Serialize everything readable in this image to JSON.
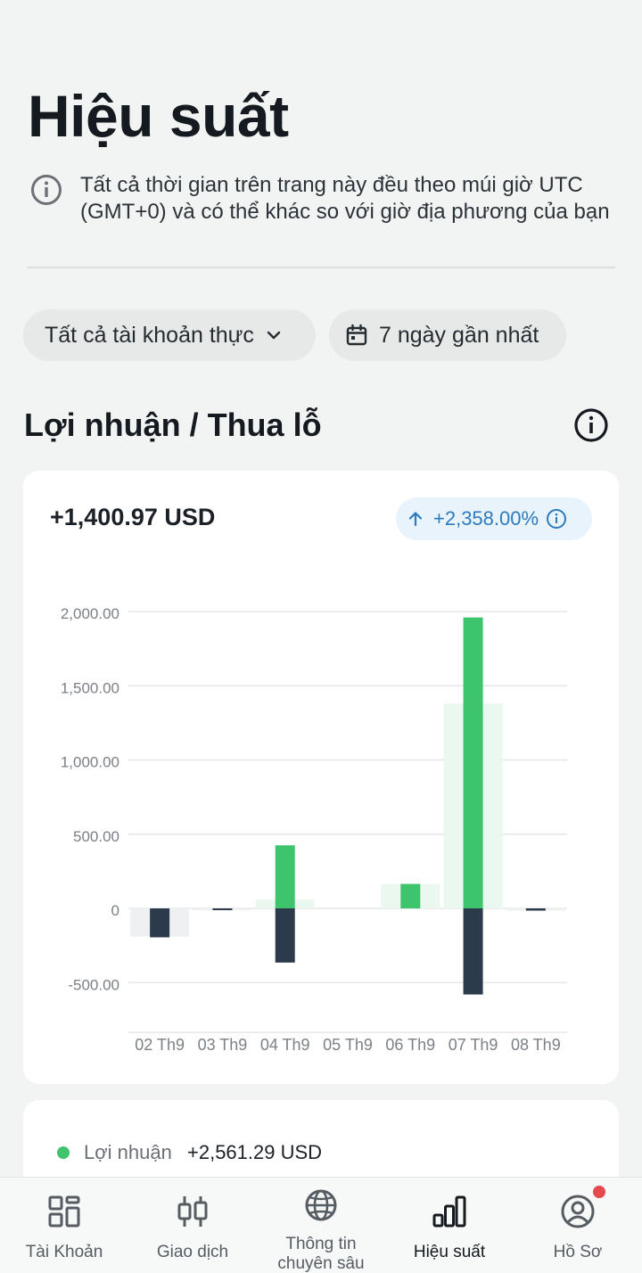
{
  "page": {
    "title": "Hiệu suất"
  },
  "notice": {
    "text": "Tất cả thời gian trên trang này đều theo múi giờ UTC (GMT+0) và có thể khác so với giờ địa phương của bạn",
    "icon": "info-icon"
  },
  "filters": {
    "account": {
      "label": "Tất cả tài khoản thực",
      "icon": "chevron-down-icon"
    },
    "range": {
      "label": "7 ngày gần nhất",
      "icon": "calendar-icon"
    }
  },
  "pnl": {
    "title": "Lợi nhuận / Thua lỗ",
    "total": "+1,400.97 USD",
    "change": "+2,358.00%"
  },
  "chart_data": {
    "type": "bar",
    "categories": [
      "02 Th9",
      "03 Th9",
      "04 Th9",
      "05 Th9",
      "06 Th9",
      "07 Th9",
      "08 Th9"
    ],
    "series": [
      {
        "values": [
          0,
          0,
          425,
          0,
          165,
          1960,
          0
        ],
        "color": "#3ec46d"
      },
      {
        "values": [
          -195,
          -5,
          -365,
          0,
          0,
          -580,
          -15
        ],
        "color": "#2c3b4c"
      },
      {
        "values": [
          -190,
          -5,
          60,
          0,
          165,
          1380,
          -15
        ],
        "color": "#eaf8ef"
      }
    ],
    "ytick_labels": [
      "2,000.00",
      "1,500.00",
      "1,000.00",
      "500.00",
      "0",
      "-500.00"
    ],
    "ytick_values": [
      2000,
      1500,
      1000,
      500,
      0,
      -500
    ],
    "ylim": [
      -700,
      2000
    ],
    "grid": true
  },
  "legend": {
    "profit_label": "Lợi nhuận",
    "profit_value": "+2,561.29 USD",
    "profit_color": "#3ec46d"
  },
  "nav": {
    "items": [
      {
        "label": "Tài Khoản",
        "icon": "accounts-grid-icon"
      },
      {
        "label": "Giao dịch",
        "icon": "candlestick-icon"
      },
      {
        "label": "Thông tin chuyên sâu",
        "icon": "globe-icon"
      },
      {
        "label": "Hiệu suất",
        "icon": "bar-chart-icon"
      },
      {
        "label": "Hồ Sơ",
        "icon": "profile-icon"
      }
    ]
  },
  "colors": {
    "accent_blue": "#2d7bbd",
    "profit_green": "#3ec46d",
    "loss_navy": "#2c3b4c",
    "net_bg_green": "#eaf8ef",
    "net_bg_gray": "#eef0f2",
    "notification_red": "#e5484d"
  }
}
